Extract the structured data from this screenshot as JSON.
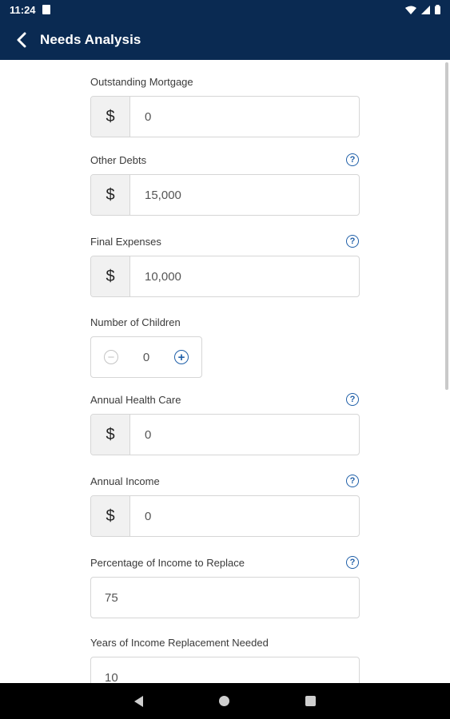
{
  "status_bar": {
    "time": "11:24"
  },
  "app_bar": {
    "title": "Needs Analysis"
  },
  "fields": [
    {
      "label": "Outstanding Mortgage",
      "prefix": "$",
      "value": "0",
      "help": false
    },
    {
      "label": "Other Debts",
      "prefix": "$",
      "value": "15,000",
      "help": true
    },
    {
      "label": "Final Expenses",
      "prefix": "$",
      "value": "10,000",
      "help": true
    },
    {
      "label": "Number of Children",
      "value": "0"
    },
    {
      "label": "Annual Health Care",
      "prefix": "$",
      "value": "0",
      "help": true
    },
    {
      "label": "Annual Income",
      "prefix": "$",
      "value": "0",
      "help": true
    },
    {
      "label": "Percentage of Income to Replace",
      "value": "75",
      "help": true
    },
    {
      "label": "Years of Income Replacement Needed",
      "value": "10",
      "help": false
    }
  ],
  "help_glyph": "?",
  "stepper": {
    "minus_glyph": "−",
    "plus_glyph": "+"
  },
  "colors": {
    "header": "#0a2a52",
    "accent": "#1f5fa8"
  }
}
